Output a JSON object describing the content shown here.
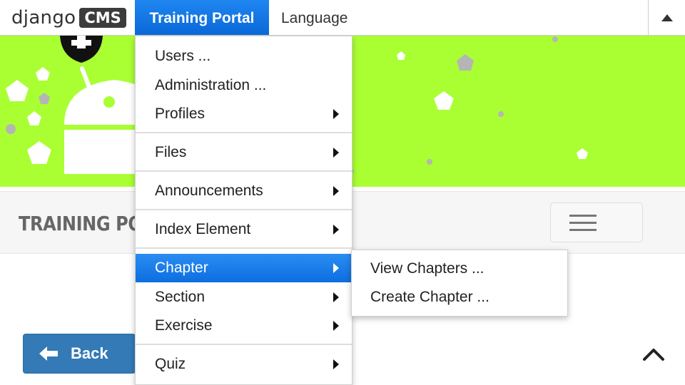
{
  "toolbar": {
    "logo_text": "django",
    "logo_badge": "CMS",
    "items": [
      {
        "label": "Training Portal",
        "active": true
      },
      {
        "label": "Language",
        "active": false
      }
    ],
    "collapse_icon": "triangle-up-icon"
  },
  "menu": {
    "items": [
      {
        "label": "Users ...",
        "submenu": false
      },
      {
        "label": "Administration ...",
        "submenu": false
      },
      {
        "label": "Profiles",
        "submenu": true
      },
      {
        "label": "Files",
        "submenu": true
      },
      {
        "label": "Announcements",
        "submenu": true
      },
      {
        "label": "Index Element",
        "submenu": true
      },
      {
        "label": "Chapter",
        "submenu": true,
        "active": true
      },
      {
        "label": "Section",
        "submenu": true
      },
      {
        "label": "Exercise",
        "submenu": true
      },
      {
        "label": "Quiz",
        "submenu": true
      }
    ]
  },
  "submenu": {
    "items": [
      {
        "label": "View Chapters ..."
      },
      {
        "label": "Create Chapter ..."
      }
    ]
  },
  "site": {
    "title": "TRAINING PORTAL",
    "menu_icon": "hamburger-icon"
  },
  "back_button": {
    "label": "Back",
    "icon": "arrow-left-icon"
  },
  "scroll_top_icon": "chevron-up-icon",
  "colors": {
    "accent": "#1378e8",
    "banner": "#a9ff32",
    "back_button": "#337ab7"
  }
}
